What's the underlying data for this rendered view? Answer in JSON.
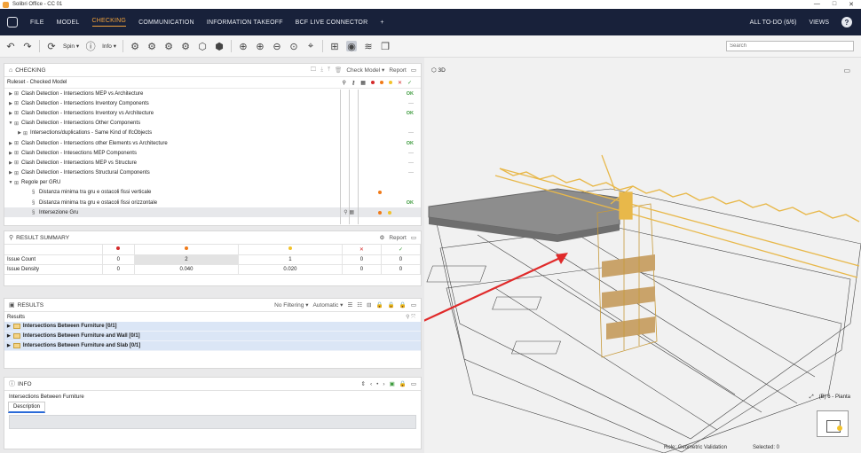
{
  "titlebar": {
    "title": "Solibri Office - CC 01",
    "min": "—",
    "max": "□",
    "close": "✕"
  },
  "menu": {
    "items": [
      "FILE",
      "MODEL",
      "CHECKING",
      "COMMUNICATION",
      "INFORMATION TAKEOFF",
      "BCF LIVE CONNECTOR",
      "+"
    ],
    "active": "CHECKING",
    "todo": "ALL TO-DO (6/6)",
    "views": "VIEWS",
    "help": "?"
  },
  "toolbar": {
    "spin": "Spin ▾",
    "info": "Info ▾",
    "search_placeholder": "Search"
  },
  "checking": {
    "title": "CHECKING",
    "check_model": "Check Model ▾",
    "report": "Report",
    "ruleset_header": "Ruleset - Checked Model",
    "rows": [
      {
        "label": "Clash Detection - Intersections MEP vs Architecture",
        "indent": 0,
        "status": "OK"
      },
      {
        "label": "Clash Detection - Intersections Inventory Components",
        "indent": 0,
        "status": "—"
      },
      {
        "label": "Clash Detection - Intersections Inventory vs Architecture",
        "indent": 0,
        "status": "OK"
      },
      {
        "label": "Clash Detection - Intersections Other Components",
        "indent": 0,
        "status": ""
      },
      {
        "label": "Intersections/duplications - Same Kind of IfcObjects",
        "indent": 1,
        "status": "—"
      },
      {
        "label": "Clash Detection - Intersections other Elements vs Architecture",
        "indent": 0,
        "status": "OK"
      },
      {
        "label": "Clash Detection - Intesections MEP Components",
        "indent": 0,
        "status": "—"
      },
      {
        "label": "Clash Detection - Intersections MEP vs Structure",
        "indent": 0,
        "status": "—"
      },
      {
        "label": "Clash Detection - Intersections Structural Components",
        "indent": 0,
        "status": "—"
      },
      {
        "label": "Regole per GRU",
        "indent": 0,
        "status": ""
      },
      {
        "label": "Distanza minima tra gru e ostacoli fissi verticale",
        "indent": 2,
        "status": "orange"
      },
      {
        "label": "Distanza minima tra gru e ostacoli fissi orizzontale",
        "indent": 2,
        "status": "OK"
      },
      {
        "label": "Intersezione Gru",
        "indent": 2,
        "status": "orange-yellow"
      }
    ]
  },
  "summary": {
    "title": "RESULT SUMMARY",
    "report": "Report",
    "check_mark": "✓",
    "cross_mark": "✕",
    "issue_count_label": "Issue Count",
    "issue_density_label": "Issue Density",
    "issue_count": [
      "0",
      "2",
      "1",
      "0",
      "0"
    ],
    "issue_density": [
      "0",
      "0.040",
      "0.020",
      "0",
      "0"
    ]
  },
  "results": {
    "title": "RESULTS",
    "filter": "No Filtering ▾",
    "automatic": "Automatic ▾",
    "list_header": "Results",
    "rows": [
      "Intersections Between Furniture [0/1]",
      "Intersections Between Furniture and Wall [0/1]",
      "Intersections Between Furniture and Slab [0/1]"
    ]
  },
  "info": {
    "title": "INFO",
    "subtitle": "Intersections Between Furniture",
    "tab": "Description"
  },
  "viewport": {
    "label": "3D",
    "plan_label": "(B) 6 - Pianta"
  },
  "status": {
    "role": "Role: Geometric Validation",
    "selected": "Selected: 0"
  },
  "colors": {
    "accent": "#f2a23a",
    "menubar": "#18213a",
    "selection": "#dbe6f6",
    "crane": "#e8b84a",
    "arrow": "#e02a2a"
  }
}
